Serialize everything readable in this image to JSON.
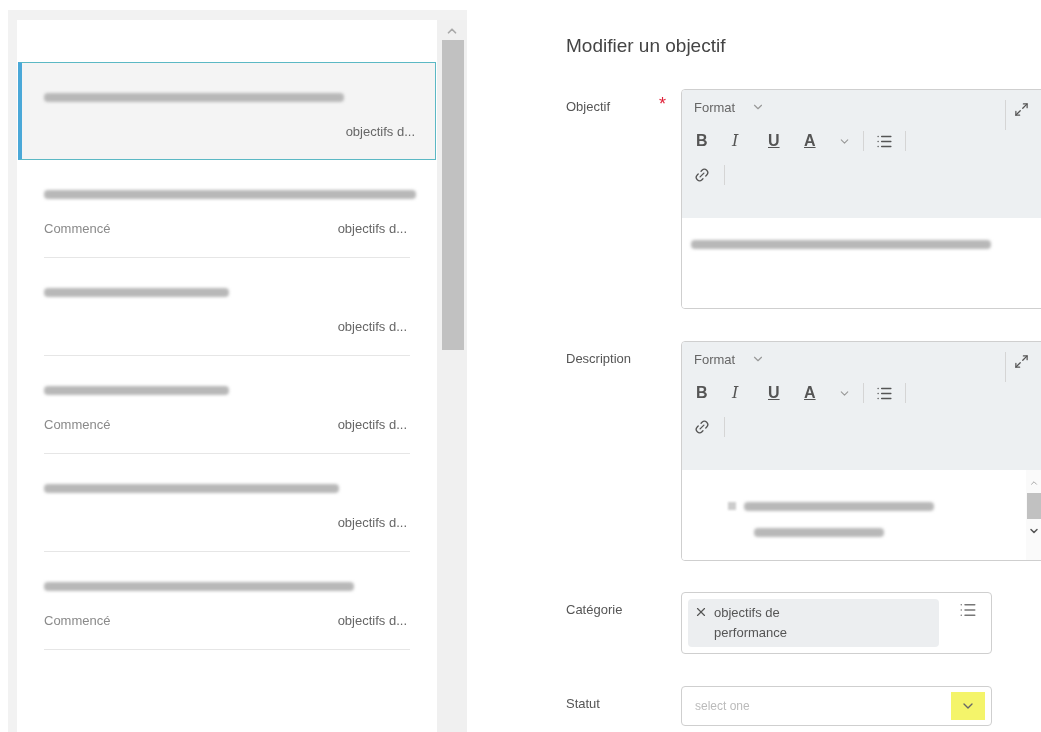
{
  "goal_list": {
    "items": [
      {
        "selected": true,
        "category": "objectifs d..."
      },
      {
        "selected": false,
        "status": "Commencé",
        "category": "objectifs d..."
      },
      {
        "selected": false,
        "category": "objectifs d..."
      },
      {
        "selected": false,
        "status": "Commencé",
        "category": "objectifs d..."
      },
      {
        "selected": false,
        "category": "objectifs d..."
      },
      {
        "selected": false,
        "status": "Commencé",
        "category": "objectifs d..."
      }
    ]
  },
  "form": {
    "title": "Modifier un objectif",
    "fields": [
      {
        "kind": "rich_text",
        "label": "Objectif",
        "required_mark": "*",
        "format": "Format",
        "buttons": [
          "B",
          "I",
          "U",
          "A"
        ],
        "scrollbar": false
      },
      {
        "kind": "rich_text",
        "label": "Description",
        "format": "Format",
        "buttons": [
          "B",
          "I",
          "U",
          "A"
        ],
        "scrollbar": true
      },
      {
        "kind": "multiselect",
        "label": "Catégorie",
        "chips": [
          "objectifs de performance"
        ]
      },
      {
        "kind": "select",
        "label": "Statut",
        "placeholder": "select one",
        "highlighted": true
      }
    ]
  }
}
